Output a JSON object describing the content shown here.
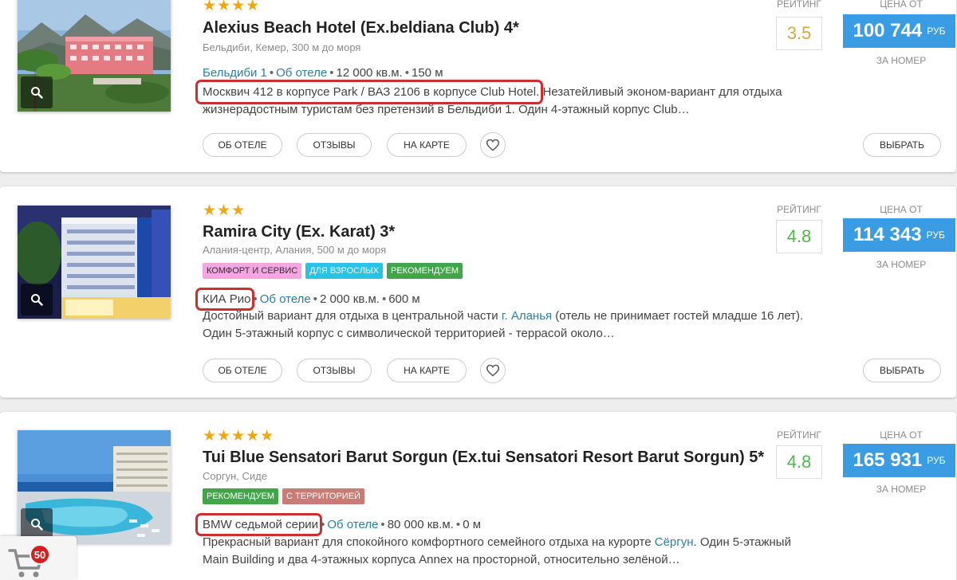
{
  "hotels": [
    {
      "stars": "★★★★",
      "name": "Alexius Beach Hotel (Ex.beldiana Club) 4*",
      "location": "Бельдиби, Кемер, 300 м до моря",
      "tags": [],
      "area_link": "Бельдиби 1",
      "about_link": "Об отеле",
      "territory": "12 000 кв.м.",
      "distance": "150 м",
      "car": "Москвич 412 в корпусе Park / ВАЗ 2106 в корпусе Club Hotel.",
      "desc_rest": " Незатейливый эконом-вариант для отдыха жизнерадостным туристам без претензий в Бельдиби 1. Один 4-этажный корпус Club…",
      "rating_label": "Рейтинг",
      "rating": "3.5",
      "rating_color": "#d8a63f",
      "price_label": "Цена от",
      "price": "100 744",
      "currency": "руб",
      "price_note": "за номер"
    },
    {
      "stars": "★★★",
      "name": "Ramira City (Ex. Karat) 3*",
      "location": "Алания-центр, Алания, 500 м до моря",
      "tags": [
        {
          "label": "Комфорт и сервис",
          "color": "#f3a6e1"
        },
        {
          "label": "Для взрослых",
          "color": "#29c2e8"
        },
        {
          "label": "Рекомендуем",
          "color": "#41a64a"
        }
      ],
      "car": "КИА Рио",
      "about_link": "Об отеле",
      "territory": "2 000 кв.м.",
      "distance": "600 м",
      "desc_pre": "Достойный вариант для отдыха в центральной части ",
      "desc_link": "г. Аланья",
      "desc_rest": " (отель не принимает гостей младше 16 лет). Один 5-этажный корпус с символической территорией - террасой около…",
      "rating_label": "Рейтинг",
      "rating": "4.8",
      "rating_color": "#4cba45",
      "price_label": "Цена от",
      "price": "114 343",
      "currency": "руб",
      "price_note": "за номер"
    },
    {
      "stars": "★★★★★",
      "name": "Tui Blue Sensatori Barut Sorgun (Ex.tui Sensatori Resort Barut Sorgun) 5*",
      "location": "Соргун, Сиде",
      "tags": [
        {
          "label": "Рекомендуем",
          "color": "#41a64a"
        },
        {
          "label": "С территорией",
          "color": "#c97b76"
        }
      ],
      "car": "BMW седьмой серии",
      "about_link": "Об отеле",
      "territory": "80 000 кв.м.",
      "distance": "0 м",
      "desc_pre": "Прекрасный вариант для спокойного комфортного семейного отдыха на курорте ",
      "desc_link": "Сёргун",
      "desc_rest": ". Один 5-этажный Main Building и два 4-этажных корпуса Annex на просторной, относительно зелёной…",
      "rating_label": "Рейтинг",
      "rating": "4.8",
      "rating_color": "#4cba45",
      "price_label": "Цена от",
      "price": "165 931",
      "currency": "руб",
      "price_note": "за номер"
    }
  ],
  "buttons": {
    "about": "Об отеле",
    "reviews": "Отзывы",
    "map": "На карте",
    "select": "Выбрать"
  },
  "cart": {
    "count": "50"
  },
  "icons": {
    "zoom": "search-icon",
    "favorite": "heart-outline-icon",
    "cart": "shopping-cart-icon"
  }
}
